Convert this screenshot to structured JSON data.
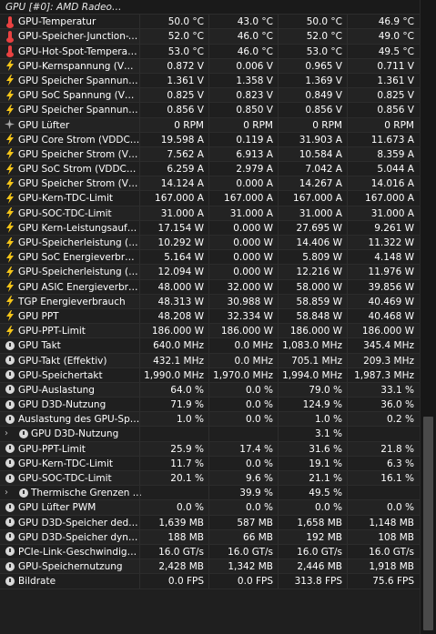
{
  "section_title": "GPU [#0]: AMD Radeon ...",
  "rows": [
    {
      "icon": "temp",
      "label": "GPU-Temperatur",
      "v": [
        "50.0 °C",
        "43.0 °C",
        "50.0 °C",
        "46.9 °C"
      ]
    },
    {
      "icon": "temp",
      "label": "GPU-Speicher-Junction-T...",
      "v": [
        "52.0 °C",
        "46.0 °C",
        "52.0 °C",
        "49.0 °C"
      ]
    },
    {
      "icon": "temp",
      "label": "GPU-Hot-Spot-Temperatur",
      "v": [
        "53.0 °C",
        "46.0 °C",
        "53.0 °C",
        "49.5 °C"
      ]
    },
    {
      "icon": "volt",
      "label": "GPU-Kernspannung (VDD...",
      "v": [
        "0.872 V",
        "0.006 V",
        "0.965 V",
        "0.711 V"
      ]
    },
    {
      "icon": "volt",
      "label": "GPU Speicher Spannung ...",
      "v": [
        "1.361 V",
        "1.358 V",
        "1.369 V",
        "1.361 V"
      ]
    },
    {
      "icon": "volt",
      "label": "GPU SoC Spannung (VD...",
      "v": [
        "0.825 V",
        "0.823 V",
        "0.849 V",
        "0.825 V"
      ]
    },
    {
      "icon": "volt",
      "label": "GPU Speicher Spannung ...",
      "v": [
        "0.856 V",
        "0.850 V",
        "0.856 V",
        "0.856 V"
      ]
    },
    {
      "icon": "fan",
      "label": "GPU Lüfter",
      "v": [
        "0 RPM",
        "0 RPM",
        "0 RPM",
        "0 RPM"
      ]
    },
    {
      "icon": "volt",
      "label": "GPU Core Strom (VDDCR...",
      "v": [
        "19.598 A",
        "0.119 A",
        "31.903 A",
        "11.673 A"
      ]
    },
    {
      "icon": "volt",
      "label": "GPU Speicher Strom (VD...",
      "v": [
        "7.562 A",
        "6.913 A",
        "10.584 A",
        "8.359 A"
      ]
    },
    {
      "icon": "volt",
      "label": "GPU SoC Strom (VDDCR...",
      "v": [
        "6.259 A",
        "2.979 A",
        "7.042 A",
        "5.044 A"
      ]
    },
    {
      "icon": "volt",
      "label": "GPU Speicher Strom (VD...",
      "v": [
        "14.124 A",
        "0.000 A",
        "14.267 A",
        "14.016 A"
      ]
    },
    {
      "icon": "volt",
      "label": "GPU-Kern-TDC-Limit",
      "v": [
        "167.000 A",
        "167.000 A",
        "167.000 A",
        "167.000 A"
      ]
    },
    {
      "icon": "volt",
      "label": "GPU-SOC-TDC-Limit",
      "v": [
        "31.000 A",
        "31.000 A",
        "31.000 A",
        "31.000 A"
      ]
    },
    {
      "icon": "volt",
      "label": "GPU Kern-Leistungsaufn...",
      "v": [
        "17.154 W",
        "0.000 W",
        "27.695 W",
        "9.261 W"
      ]
    },
    {
      "icon": "volt",
      "label": "GPU-Speicherleistung (V...",
      "v": [
        "10.292 W",
        "0.000 W",
        "14.406 W",
        "11.322 W"
      ]
    },
    {
      "icon": "volt",
      "label": "GPU SoC Energieverbrau...",
      "v": [
        "5.164 W",
        "0.000 W",
        "5.809 W",
        "4.148 W"
      ]
    },
    {
      "icon": "volt",
      "label": "GPU-Speicherleistung (V...",
      "v": [
        "12.094 W",
        "0.000 W",
        "12.216 W",
        "11.976 W"
      ]
    },
    {
      "icon": "volt",
      "label": "GPU ASIC Energieverbra...",
      "v": [
        "48.000 W",
        "32.000 W",
        "58.000 W",
        "39.856 W"
      ]
    },
    {
      "icon": "volt",
      "label": "TGP Energieverbrauch",
      "v": [
        "48.313 W",
        "30.988 W",
        "58.859 W",
        "40.469 W"
      ]
    },
    {
      "icon": "volt",
      "label": "GPU PPT",
      "v": [
        "48.208 W",
        "32.334 W",
        "58.848 W",
        "40.468 W"
      ]
    },
    {
      "icon": "volt",
      "label": "GPU-PPT-Limit",
      "v": [
        "186.000 W",
        "186.000 W",
        "186.000 W",
        "186.000 W"
      ]
    },
    {
      "icon": "clock",
      "label": "GPU Takt",
      "v": [
        "640.0 MHz",
        "0.0 MHz",
        "1,083.0 MHz",
        "345.4 MHz"
      ]
    },
    {
      "icon": "clock",
      "label": "GPU-Takt (Effektiv)",
      "v": [
        "432.1 MHz",
        "0.0 MHz",
        "705.1 MHz",
        "209.3 MHz"
      ]
    },
    {
      "icon": "clock",
      "label": "GPU-Speichertakt",
      "v": [
        "1,990.0 MHz",
        "1,970.0 MHz",
        "1,994.0 MHz",
        "1,987.3 MHz"
      ]
    },
    {
      "icon": "clock",
      "label": "GPU-Auslastung",
      "v": [
        "64.0 %",
        "0.0 %",
        "79.0 %",
        "33.1 %"
      ]
    },
    {
      "icon": "clock",
      "label": "GPU D3D-Nutzung",
      "v": [
        "71.9 %",
        "0.0 %",
        "124.9 %",
        "36.0 %"
      ]
    },
    {
      "icon": "clock",
      "label": "Auslastung des GPU-Spe...",
      "v": [
        "1.0 %",
        "0.0 %",
        "1.0 %",
        "0.2 %"
      ]
    },
    {
      "icon": "clock",
      "label": "GPU D3D-Nutzung",
      "v": [
        "",
        "",
        "3.1 %",
        ""
      ],
      "sub": true
    },
    {
      "icon": "clock",
      "label": "GPU-PPT-Limit",
      "v": [
        "25.9 %",
        "17.4 %",
        "31.6 %",
        "21.8 %"
      ]
    },
    {
      "icon": "clock",
      "label": "GPU-Kern-TDC-Limit",
      "v": [
        "11.7 %",
        "0.0 %",
        "19.1 %",
        "6.3 %"
      ]
    },
    {
      "icon": "clock",
      "label": "GPU-SOC-TDC-Limit",
      "v": [
        "20.1 %",
        "9.6 %",
        "21.1 %",
        "16.1 %"
      ]
    },
    {
      "icon": "clock",
      "label": "Thermische Grenzen ...",
      "v": [
        "",
        "39.9 %",
        "49.5 %",
        ""
      ],
      "sub": true
    },
    {
      "icon": "clock",
      "label": "GPU Lüfter PWM",
      "v": [
        "0.0 %",
        "0.0 %",
        "0.0 %",
        "0.0 %"
      ]
    },
    {
      "icon": "clock",
      "label": "GPU D3D-Speicher dedizi...",
      "v": [
        "1,639 MB",
        "587 MB",
        "1,658 MB",
        "1,148 MB"
      ]
    },
    {
      "icon": "clock",
      "label": "GPU D3D-Speicher dyna...",
      "v": [
        "188 MB",
        "66 MB",
        "192 MB",
        "108 MB"
      ]
    },
    {
      "icon": "clock",
      "label": "PCIe-Link-Geschwindigkeit",
      "v": [
        "16.0 GT/s",
        "16.0 GT/s",
        "16.0 GT/s",
        "16.0 GT/s"
      ]
    },
    {
      "icon": "clock",
      "label": "GPU-Speichernutzung",
      "v": [
        "2,428 MB",
        "1,342 MB",
        "2,446 MB",
        "1,918 MB"
      ]
    },
    {
      "icon": "clock",
      "label": "Bildrate",
      "v": [
        "0.0 FPS",
        "0.0 FPS",
        "313.8 FPS",
        "75.6 FPS"
      ]
    }
  ]
}
